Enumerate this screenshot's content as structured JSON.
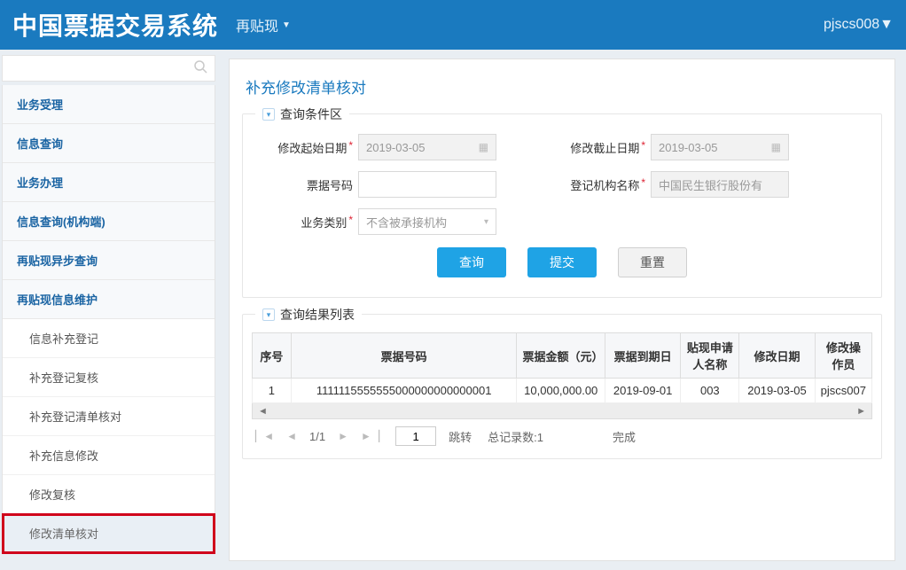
{
  "topbar": {
    "title": "中国票据交易系统",
    "menu_label": "再贴现",
    "user": "pjscs008"
  },
  "sidebar": {
    "items": [
      {
        "label": "业务受理",
        "type": "top"
      },
      {
        "label": "信息查询",
        "type": "top"
      },
      {
        "label": "业务办理",
        "type": "top"
      },
      {
        "label": "信息查询(机构端)",
        "type": "top"
      },
      {
        "label": "再贴现异步查询",
        "type": "top"
      },
      {
        "label": "再贴现信息维护",
        "type": "top"
      },
      {
        "label": "信息补充登记",
        "type": "sub"
      },
      {
        "label": "补充登记复核",
        "type": "sub"
      },
      {
        "label": "补充登记清单核对",
        "type": "sub"
      },
      {
        "label": "补充信息修改",
        "type": "sub"
      },
      {
        "label": "修改复核",
        "type": "sub"
      },
      {
        "label": "修改清单核对",
        "type": "sub",
        "active": true,
        "highlighted": true
      }
    ]
  },
  "page": {
    "title": "补充修改清单核对",
    "legend_search": "查询条件区",
    "legend_result": "查询结果列表"
  },
  "form": {
    "start_date": {
      "label": "修改起始日期",
      "value": "2019-03-05",
      "required": true
    },
    "end_date": {
      "label": "修改截止日期",
      "value": "2019-03-05",
      "required": true
    },
    "bill_no": {
      "label": "票据号码",
      "value": ""
    },
    "org_name": {
      "label": "登记机构名称",
      "value": "中国民生银行股份有",
      "required": true,
      "disabled": true
    },
    "biz_type": {
      "label": "业务类别",
      "value": "不含被承接机构",
      "required": true
    }
  },
  "buttons": {
    "search": "查询",
    "submit": "提交",
    "reset": "重置"
  },
  "table": {
    "cols": [
      "序号",
      "票据号码",
      "票据金额（元）",
      "票据到期日",
      "贴现申请人名称",
      "修改日期",
      "修改操作员"
    ],
    "rows": [
      {
        "seq": "1",
        "bill_no": "1111115555555000000000000001",
        "amount": "10,000,000.00",
        "due": "2019-09-01",
        "applicant": "003",
        "mod_date": "2019-03-05",
        "operator": "pjscs007"
      }
    ]
  },
  "pager": {
    "page_text": "1/1",
    "page_value": "1",
    "jump": "跳转",
    "total": "总记录数:1",
    "status": "完成"
  }
}
